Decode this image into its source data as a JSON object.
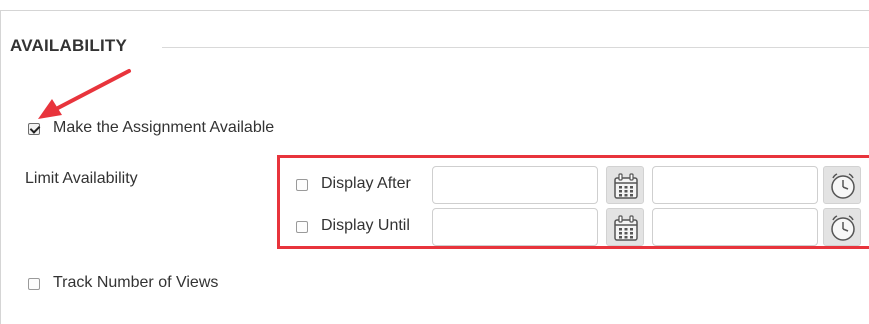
{
  "section": {
    "title": "AVAILABILITY"
  },
  "make_available": {
    "label": "Make the Assignment Available",
    "checked": true
  },
  "limit_availability": {
    "label": "Limit Availability",
    "display_after": {
      "label": "Display After",
      "checked": false,
      "date_value": "",
      "time_value": ""
    },
    "display_until": {
      "label": "Display Until",
      "checked": false,
      "date_value": "",
      "time_value": ""
    }
  },
  "track_views": {
    "label": "Track Number of Views",
    "checked": false
  },
  "icons": {
    "date": "calendar-icon",
    "time": "clock-icon"
  },
  "colors": {
    "annotation": "#e8343c",
    "text": "#333333"
  }
}
